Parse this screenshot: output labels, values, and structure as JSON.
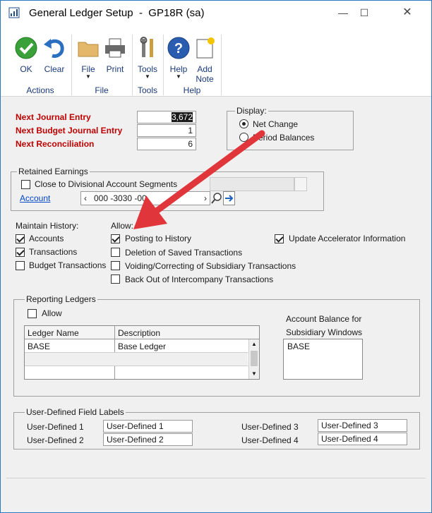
{
  "window": {
    "title": "General Ledger Setup",
    "company": "GP18R (sa)"
  },
  "ribbon": {
    "ok": "OK",
    "clear": "Clear",
    "file": "File",
    "print": "Print",
    "tools": "Tools",
    "help": "Help",
    "add_note_1": "Add",
    "add_note_2": "Note",
    "groups": {
      "actions": "Actions",
      "file": "File",
      "tools": "Tools",
      "help": "Help"
    }
  },
  "numbers": {
    "next_journal_label": "Next Journal Entry",
    "next_journal_value": "3,672",
    "next_budget_label": "Next Budget Journal Entry",
    "next_budget_value": "1",
    "next_recon_label": "Next Reconciliation",
    "next_recon_value": "6"
  },
  "display": {
    "label": "Display:",
    "net_change": "Net Change",
    "period_balances": "Period Balances",
    "selected": "net_change"
  },
  "retained": {
    "label": "Retained Earnings",
    "close_divisional": "Close to Divisional Account Segments",
    "account_label": "Account",
    "account_value": "000 -3030 -00"
  },
  "maintain": {
    "label": "Maintain History:",
    "accounts": "Accounts",
    "transactions": "Transactions",
    "budget": "Budget Transactions"
  },
  "allow": {
    "label": "Allow:",
    "posting": "Posting to History",
    "deletion": "Deletion of Saved Transactions",
    "voiding": "Voiding/Correcting of Subsidiary Transactions",
    "backout": "Back Out of Intercompany Transactions",
    "accelerator": "Update Accelerator Information"
  },
  "reporting": {
    "label": "Reporting Ledgers",
    "allow": "Allow",
    "col_name": "Ledger Name",
    "col_desc": "Description",
    "rows": [
      {
        "name": "BASE",
        "desc": "Base Ledger"
      }
    ],
    "balance_label_1": "Account Balance for",
    "balance_label_2": "Subsidiary Windows",
    "balance_value": "BASE"
  },
  "udf": {
    "label": "User-Defined Field Labels",
    "u1_label": "User-Defined 1",
    "u1_value": "User-Defined 1",
    "u2_label": "User-Defined 2",
    "u2_value": "User-Defined 2",
    "u3_label": "User-Defined 3",
    "u3_value": "User-Defined 3",
    "u4_label": "User-Defined 4",
    "u4_value": "User-Defined 4"
  },
  "colors": {
    "accent_red": "#c00000",
    "arrow_red": "#e0353b",
    "link_blue": "#0046c8"
  }
}
